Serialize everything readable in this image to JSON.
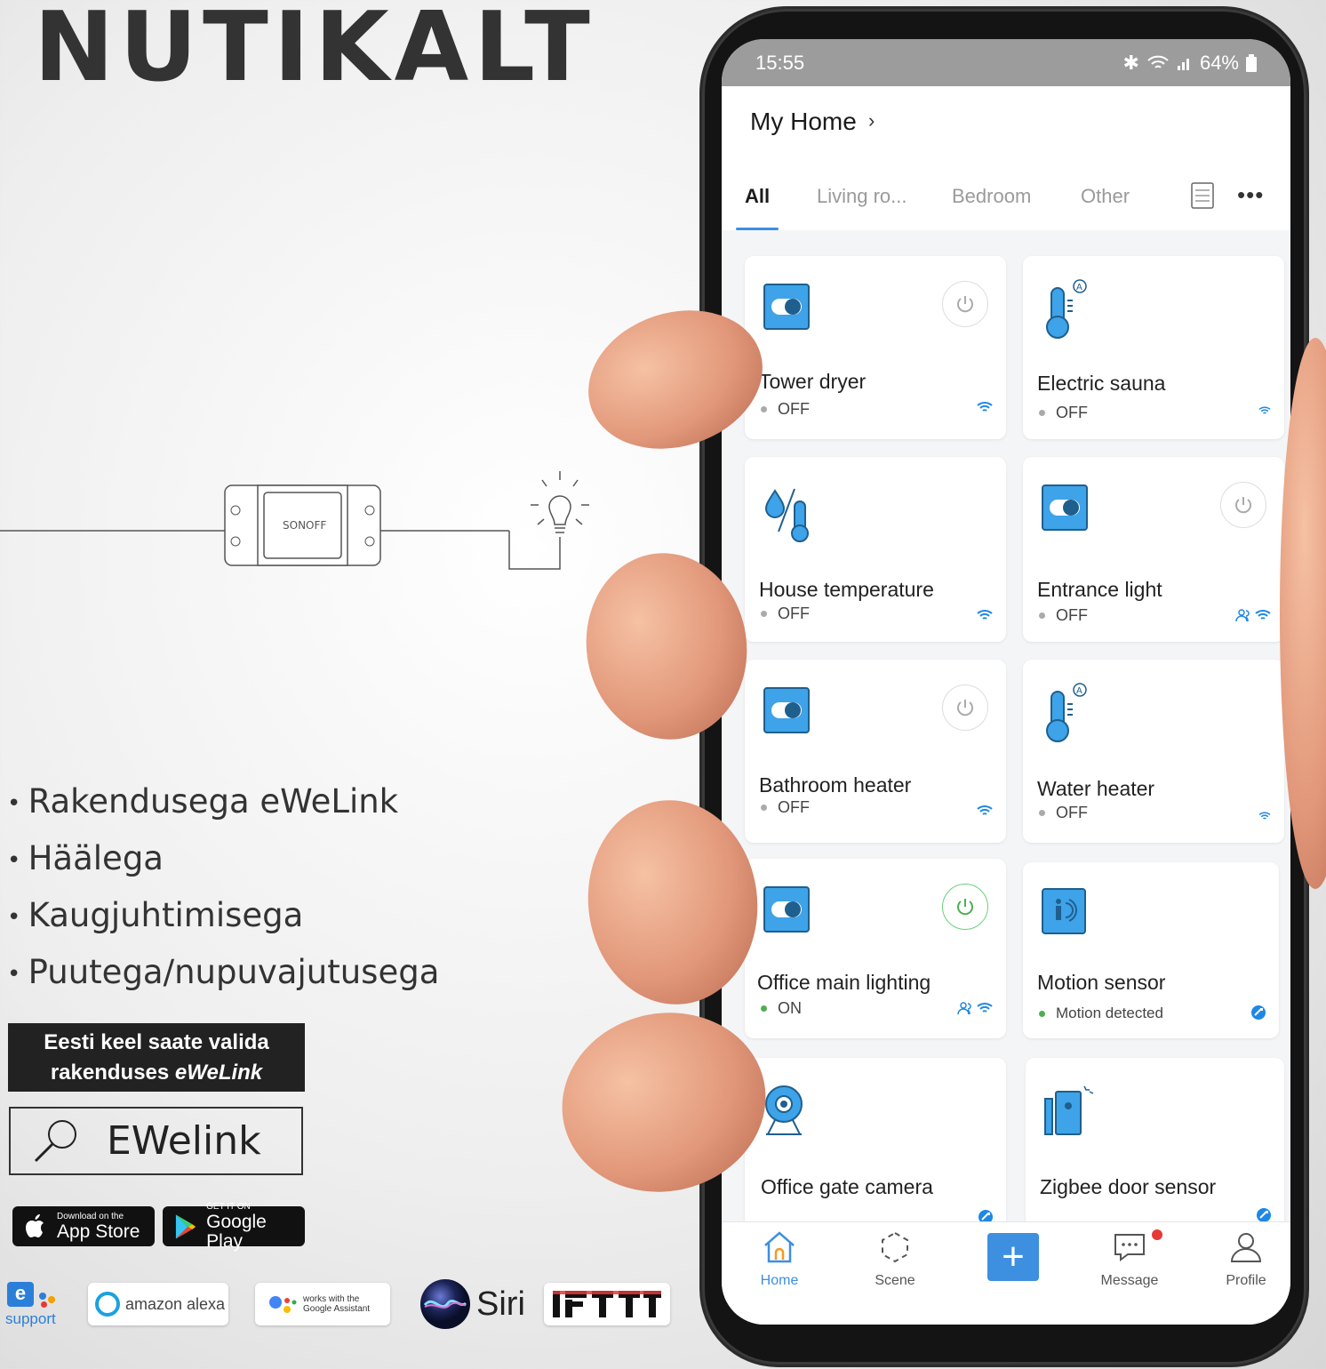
{
  "poster": {
    "headline": "NUTIKALT",
    "features": [
      "Rakendusega eWeLink",
      "Häälega",
      "Kaugjuhtimisega",
      "Puutega/nupuvajutusega"
    ],
    "language_note_line1": "Eesti keel saate valida",
    "language_note_line2_prefix": "rakenduses",
    "language_note_line2_app": "eWeLink",
    "search_term": "EWelink",
    "device_label": "SONOFF",
    "app_store": {
      "small": "Download on the",
      "big": "App Store"
    },
    "google_play": {
      "small": "GET IT ON",
      "big": "Google Play"
    },
    "partners": {
      "esupport_e": "e",
      "esupport_text": "support",
      "alexa": "amazon alexa",
      "google_line1": "works with the",
      "google_line2": "Google Assistant",
      "siri": "Siri"
    }
  },
  "phone": {
    "status_time": "15:55",
    "status_battery": "64%",
    "home_title": "My Home",
    "home_chevron": "›",
    "tabs": [
      "All",
      "Living ro...",
      "Bedroom",
      "Other"
    ],
    "more": "•••",
    "devices": [
      {
        "name": "Tower dryer",
        "status": "OFF",
        "icon": "switch-icon"
      },
      {
        "name": "Electric sauna",
        "status": "OFF",
        "icon": "thermometer-auto-icon"
      },
      {
        "name": "House temperature",
        "status": "OFF",
        "icon": "humidity-thermometer-icon"
      },
      {
        "name": "Entrance light",
        "status": "OFF",
        "icon": "switch-icon"
      },
      {
        "name": "Bathroom heater",
        "status": "OFF",
        "icon": "switch-icon"
      },
      {
        "name": "Water heater",
        "status": "OFF",
        "icon": "thermometer-auto-icon"
      },
      {
        "name": "Office main lighting",
        "status": "ON",
        "icon": "switch-icon"
      },
      {
        "name": "Motion sensor",
        "status": "Motion detected",
        "icon": "motion-sensor-icon"
      },
      {
        "name": "Office gate camera",
        "status": "",
        "icon": "camera-icon"
      },
      {
        "name": "Zigbee door sensor",
        "status": "",
        "icon": "door-sensor-icon"
      }
    ],
    "nav": {
      "home": "Home",
      "scene": "Scene",
      "add": "+",
      "message": "Message",
      "profile": "Profile"
    },
    "colors": {
      "accent": "#3d8fe0",
      "on_green": "#4caf50",
      "status_bar": "#9c9c9c"
    }
  }
}
